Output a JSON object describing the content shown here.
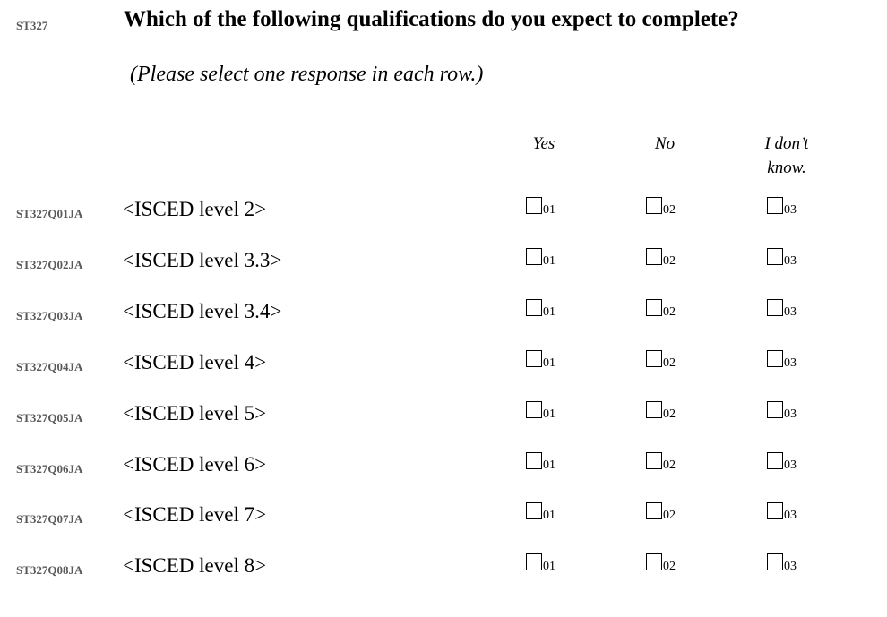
{
  "question_id": "ST327",
  "question_text": "Which of the following qualifications do you expect to complete?",
  "instruction": "(Please select one response in each row.)",
  "columns": [
    {
      "label": "Yes",
      "code": "01"
    },
    {
      "label": "No",
      "code": "02"
    },
    {
      "label": "I don’t know.",
      "code": "03"
    }
  ],
  "rows": [
    {
      "code": "ST327Q01JA",
      "label": "<ISCED level 2>"
    },
    {
      "code": "ST327Q02JA",
      "label": "<ISCED level 3.3>"
    },
    {
      "code": "ST327Q03JA",
      "label": "<ISCED level 3.4>"
    },
    {
      "code": "ST327Q04JA",
      "label": "<ISCED level 4>"
    },
    {
      "code": "ST327Q05JA",
      "label": "<ISCED level 5>"
    },
    {
      "code": "ST327Q06JA",
      "label": "<ISCED level 6>"
    },
    {
      "code": "ST327Q07JA",
      "label": "<ISCED level 7>"
    },
    {
      "code": "ST327Q08JA",
      "label": "<ISCED level 8>"
    }
  ]
}
